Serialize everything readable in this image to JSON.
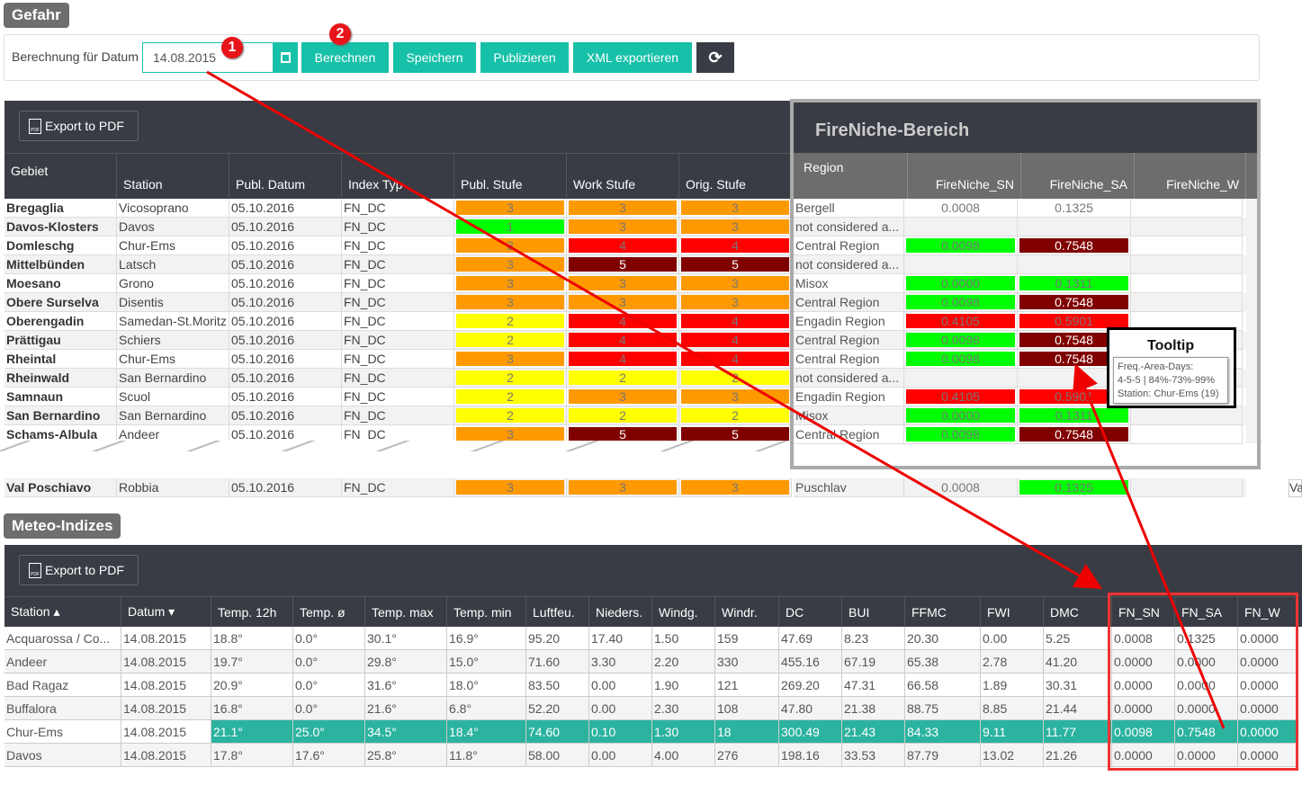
{
  "gefahr": {
    "title": "Gefahr",
    "date_label": "Berechnung für Datum",
    "date_value": "14.08.2015",
    "buttons": {
      "calc": "Berechnen",
      "save": "Speichern",
      "publish": "Publizieren",
      "xml": "XML exportieren"
    },
    "step1": "1",
    "step2": "2",
    "export_pdf": "Export to PDF",
    "columns": [
      "Gebiet",
      "Station",
      "Publ. Datum",
      "Index Typ",
      "Publ. Stufe",
      "Work Stufe",
      "Orig. Stufe"
    ],
    "rows": [
      [
        "Bregaglia",
        "Vicosoprano",
        "05.10.2016",
        "FN_DC",
        3,
        3,
        3
      ],
      [
        "Davos-Klosters",
        "Davos",
        "05.10.2016",
        "FN_DC",
        1,
        3,
        3
      ],
      [
        "Domleschg",
        "Chur-Ems",
        "05.10.2016",
        "FN_DC",
        3,
        4,
        4
      ],
      [
        "Mittelbünden",
        "Latsch",
        "05.10.2016",
        "FN_DC",
        3,
        5,
        5
      ],
      [
        "Moesano",
        "Grono",
        "05.10.2016",
        "FN_DC",
        3,
        3,
        3
      ],
      [
        "Obere Surselva",
        "Disentis",
        "05.10.2016",
        "FN_DC",
        3,
        3,
        3
      ],
      [
        "Oberengadin",
        "Samedan-St.Moritz",
        "05.10.2016",
        "FN_DC",
        2,
        4,
        4
      ],
      [
        "Prättigau",
        "Schiers",
        "05.10.2016",
        "FN_DC",
        2,
        4,
        4
      ],
      [
        "Rheintal",
        "Chur-Ems",
        "05.10.2016",
        "FN_DC",
        3,
        4,
        4
      ],
      [
        "Rheinwald",
        "San Bernardino",
        "05.10.2016",
        "FN_DC",
        2,
        2,
        2
      ],
      [
        "Samnaun",
        "Scuol",
        "05.10.2016",
        "FN_DC",
        2,
        3,
        3
      ],
      [
        "San Bernardino",
        "San Bernardino",
        "05.10.2016",
        "FN_DC",
        2,
        2,
        2
      ],
      [
        "Schams-Albula",
        "Andeer",
        "05.10.2016",
        "FN_DC",
        3,
        5,
        5
      ]
    ],
    "last_row": [
      "Val Poschiavo",
      "Robbia",
      "05.10.2016",
      "FN_DC",
      3,
      3,
      3
    ],
    "level_colors": {
      "1": "#00ff00",
      "2": "#ffff00",
      "3": "#ff9900",
      "4": "#ff0000",
      "5": "#800000"
    }
  },
  "fireniche": {
    "title": "FireNiche-Bereich",
    "columns": [
      "Region",
      "FireNiche_SN",
      "FireNiche_SA",
      "FireNiche_W"
    ],
    "rows": [
      [
        "Bergell",
        "0.0008",
        "",
        "0.1325",
        ""
      ],
      [
        "not considered a...",
        "",
        "",
        "",
        ""
      ],
      [
        "Central Region",
        "0.0098",
        "g",
        "0.7548",
        "dr"
      ],
      [
        "not considered a...",
        "",
        "",
        "",
        ""
      ],
      [
        "Misox",
        "0.0000",
        "g",
        "0.1311",
        "g"
      ],
      [
        "Central Region",
        "0.0098",
        "g",
        "0.7548",
        "dr"
      ],
      [
        "Engadin Region",
        "0.4105",
        "r",
        "0.5901",
        "r"
      ],
      [
        "Central Region",
        "0.0098",
        "g",
        "0.7548",
        "dr"
      ],
      [
        "Central Region",
        "0.0098",
        "g",
        "0.7548",
        "dr"
      ],
      [
        "not considered a...",
        "",
        "",
        "",
        ""
      ],
      [
        "Engadin Region",
        "0.4105",
        "r",
        "0.5901",
        "r"
      ],
      [
        "Misox",
        "0.0000",
        "g",
        "0.1311",
        "g"
      ],
      [
        "Central Region",
        "0.0098",
        "g",
        "0.7548",
        "dr"
      ]
    ],
    "last_row": [
      "Puschlav",
      "0.0008",
      "",
      "0.1325",
      "g"
    ],
    "cut_text": "Va",
    "tooltip": {
      "label": "Tooltip",
      "line1": "Freq.-Area-Days:",
      "line2": "4-5-5 | 84%-73%-99%",
      "line3": "Station: Chur-Ems (19)"
    }
  },
  "meteo": {
    "title": "Meteo-Indizes",
    "export_pdf": "Export to PDF",
    "columns": [
      "Station ▴",
      "Datum ▾",
      "Temp. 12h",
      "Temp. ø",
      "Temp. max",
      "Temp. min",
      "Luftfeu.",
      "Nieders.",
      "Windg.",
      "Windr.",
      "DC",
      "BUI",
      "FFMC",
      "FWI",
      "DMC",
      "FN_SN",
      "FN_SA",
      "FN_W"
    ],
    "rows": [
      [
        "Acquarossa / Co...",
        "14.08.2015",
        "18.8°",
        "0.0°",
        "30.1°",
        "16.9°",
        "95.20",
        "17.40",
        "1.50",
        "159",
        "47.69",
        "8.23",
        "20.30",
        "0.00",
        "5.25",
        "0.0008",
        "0.1325",
        "0.0000"
      ],
      [
        "Andeer",
        "14.08.2015",
        "19.7°",
        "0.0°",
        "29.8°",
        "15.0°",
        "71.60",
        "3.30",
        "2.20",
        "330",
        "455.16",
        "67.19",
        "65.38",
        "2.78",
        "41.20",
        "0.0000",
        "0.0000",
        "0.0000"
      ],
      [
        "Bad Ragaz",
        "14.08.2015",
        "20.9°",
        "0.0°",
        "31.6°",
        "18.0°",
        "83.50",
        "0.00",
        "1.90",
        "121",
        "269.20",
        "47.31",
        "66.58",
        "1.89",
        "30.31",
        "0.0000",
        "0.0000",
        "0.0000"
      ],
      [
        "Buffalora",
        "14.08.2015",
        "16.8°",
        "0.0°",
        "21.6°",
        "6.8°",
        "52.20",
        "0.00",
        "2.30",
        "108",
        "47.80",
        "21.38",
        "88.75",
        "8.85",
        "21.44",
        "0.0000",
        "0.0000",
        "0.0000"
      ],
      [
        "Chur-Ems",
        "14.08.2015",
        "21.1°",
        "25.0°",
        "34.5°",
        "18.4°",
        "74.60",
        "0.10",
        "1.30",
        "18",
        "300.49",
        "21.43",
        "84.33",
        "9.11",
        "11.77",
        "0.0098",
        "0.7548",
        "0.0000"
      ],
      [
        "Davos",
        "14.08.2015",
        "17.8°",
        "17.6°",
        "25.8°",
        "11.8°",
        "58.00",
        "0.00",
        "4.00",
        "276",
        "198.16",
        "33.53",
        "87.79",
        "13.02",
        "21.26",
        "0.0000",
        "0.0000",
        "0.0000"
      ]
    ],
    "highlight_color": "#2bb3a0"
  }
}
